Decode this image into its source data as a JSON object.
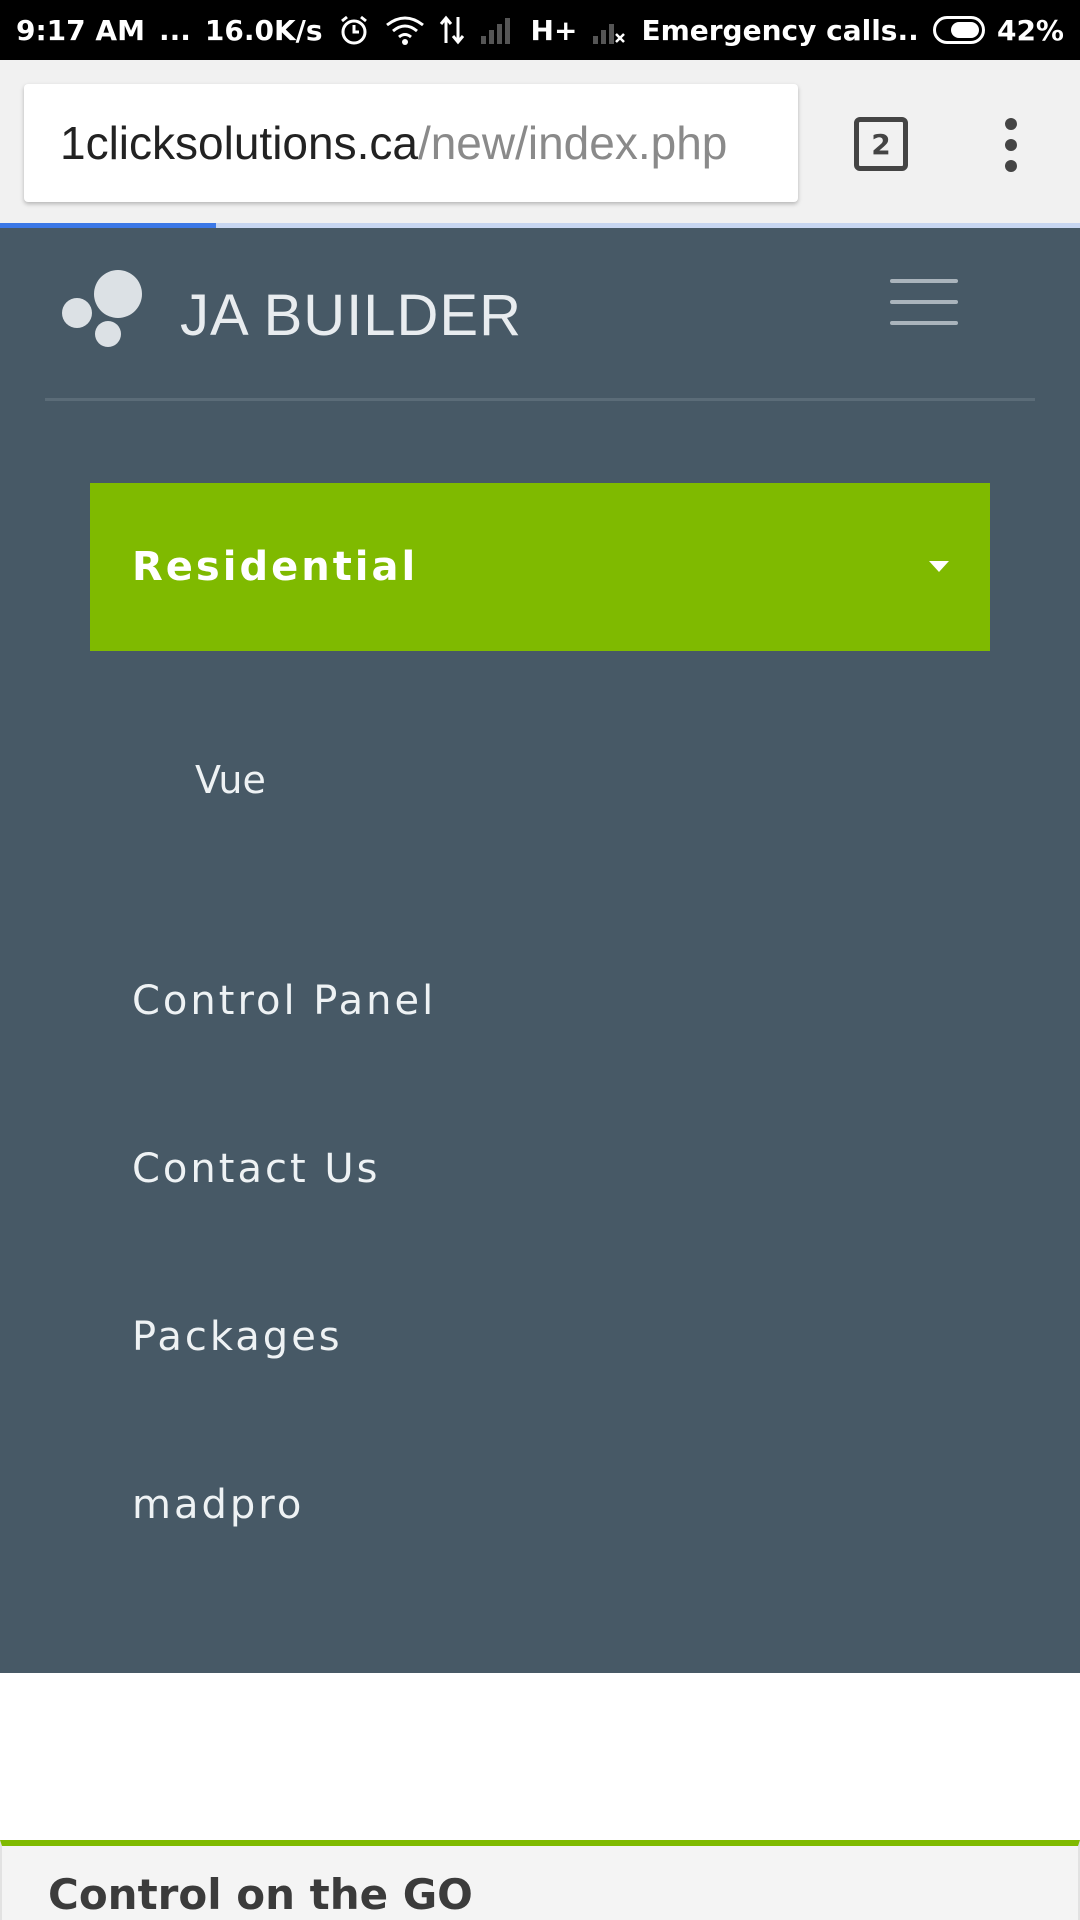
{
  "status_bar": {
    "time": "9:17 AM",
    "dots": "...",
    "speed": "16.0K/s",
    "network_type": "H+",
    "carrier_text": "Emergency calls..",
    "battery_percent": "42%",
    "icons": [
      "alarm-icon",
      "wifi-icon",
      "data-transfer-icon",
      "signal-icon",
      "no-signal-icon",
      "battery-icon"
    ]
  },
  "browser": {
    "url_domain": "1clicksolutions.ca",
    "url_path": "/new/index.php",
    "tab_count": "2",
    "load_progress": 0.2
  },
  "site": {
    "brand": "JA BUILDER",
    "menu": {
      "active_dropdown": "Residential",
      "sub_items": [
        "Vue"
      ],
      "items": [
        "Control Panel",
        "Contact Us",
        "Packages",
        "madpro"
      ]
    },
    "card_title": "Control on the GO"
  },
  "colors": {
    "nav_bg": "#475966",
    "accent": "#7fba00",
    "progress": "#3b78e7"
  }
}
